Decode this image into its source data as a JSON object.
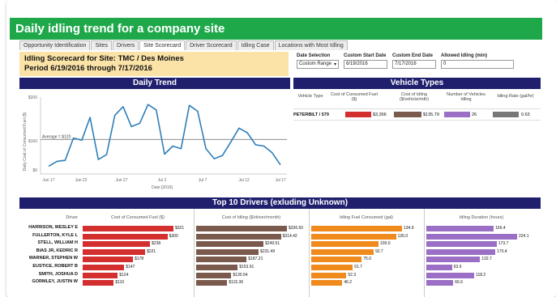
{
  "banner": {
    "title": "Daily idling trend for a company site"
  },
  "tabs": [
    {
      "label": "Opportunity Identification"
    },
    {
      "label": "Sites"
    },
    {
      "label": "Drivers"
    },
    {
      "label": "Site Scorecard"
    },
    {
      "label": "Driver Scorecard"
    },
    {
      "label": "Idling Case"
    },
    {
      "label": "Locations with Most Idling"
    }
  ],
  "scorecard": {
    "line1": "Idling Scorecard for Site: TMC / Des Moines",
    "line2": "Period 6/19/2016 through 7/17/2016"
  },
  "filters": {
    "date_selection_label": "Date Selection",
    "date_selection_value": "Custom Range",
    "start_label": "Custom Start Date",
    "start_value": "6/19/2016",
    "end_label": "Custom End Date",
    "end_value": "7/17/2016",
    "allowed_label": "Allowed Idling (min)",
    "allowed_value": "0"
  },
  "daily_trend": {
    "title": "Daily Trend",
    "ylabel": "Daily Cost of Consumed Fuel ($)",
    "xlabel": "Date [2016]",
    "average_label": "Average = $120",
    "ytick_labels": [
      "$200",
      "$100",
      "$0"
    ],
    "xtick_labels": [
      "Jun 17",
      "Jun 22",
      "Jun 27",
      "Jul 2",
      "Jul 7",
      "Jul 12",
      "Jul 17"
    ]
  },
  "chart_data": {
    "type": "line",
    "title": "Daily Trend",
    "xlabel": "Date [2016]",
    "ylabel": "Daily Cost of Consumed Fuel ($)",
    "ylim": [
      0,
      260
    ],
    "x": [
      "2016-06-19",
      "2016-06-20",
      "2016-06-21",
      "2016-06-22",
      "2016-06-23",
      "2016-06-24",
      "2016-06-25",
      "2016-06-26",
      "2016-06-27",
      "2016-06-28",
      "2016-06-29",
      "2016-06-30",
      "2016-07-01",
      "2016-07-02",
      "2016-07-03",
      "2016-07-04",
      "2016-07-05",
      "2016-07-06",
      "2016-07-07",
      "2016-07-08",
      "2016-07-09",
      "2016-07-10",
      "2016-07-11",
      "2016-07-12",
      "2016-07-13",
      "2016-07-14",
      "2016-07-15",
      "2016-07-16",
      "2016-07-17"
    ],
    "values": [
      20,
      38,
      42,
      125,
      117,
      202,
      45,
      63,
      210,
      242,
      168,
      180,
      250,
      230,
      65,
      95,
      85,
      247,
      225,
      85,
      48,
      60,
      110,
      162,
      145,
      100,
      95,
      70,
      25
    ],
    "average": 120,
    "grid": false
  },
  "vehicle_types": {
    "title": "Vehicle Types",
    "headers": [
      "Vehicle Type",
      "Cost of Consumed Fuel ($)",
      "Cost of Idling ($/vehicle/mth)",
      "Number of Vehicles Idling",
      "Idling Rate (gal/hr)"
    ],
    "row": {
      "type": "PETERBILT / 579",
      "fuel": "$3,366",
      "idling": "$135.79",
      "vehicles": "26",
      "rate": "0.63"
    },
    "colors": {
      "fuel": "#d32f2f",
      "idling": "#7b5a4e",
      "vehicles": "#9b6fc5",
      "rate": "#777777"
    }
  },
  "top_drivers": {
    "title": "Top 10 Drivers (exluding Unknown)",
    "headers": [
      "Driver",
      "Cost of Consumed Fuel ($)",
      "Cost of Idling ($/driver/month)",
      "Idling Fuel Consumed (gal)",
      "Idling Duration (hours)"
    ],
    "colors": {
      "fuel": "#d32f2f",
      "idling": "#7b5a4e",
      "gal": "#f08a1c",
      "hours": "#9b6fc5"
    },
    "rows": [
      {
        "name": "HARRISON, WESLEY E",
        "fuel": 321,
        "fuel_label": "$321",
        "idling": 336.5,
        "idling_label": "$336.50",
        "gal": 134.9,
        "gal_label": "134.9",
        "hours": 166.4,
        "hours_label": "166.4"
      },
      {
        "name": "FULLERTON, KYLE L",
        "fuel": 300,
        "fuel_label": "$300",
        "idling": 314.42,
        "idling_label": "$314.42",
        "gal": 126.0,
        "gal_label": "126.0",
        "hours": 224.1,
        "hours_label": "224.1"
      },
      {
        "name": "STELL, WILLIAM H",
        "fuel": 238,
        "fuel_label": "$238",
        "idling": 249.51,
        "idling_label": "$249.51",
        "gal": 100.0,
        "gal_label": "100.0",
        "hours": 173.7,
        "hours_label": "173.7"
      },
      {
        "name": "BIAS JR, KEDRIC R",
        "fuel": 221,
        "fuel_label": "$221",
        "idling": 231.49,
        "idling_label": "$231.49",
        "gal": 92.7,
        "gal_label": "92.7",
        "hours": 170.4,
        "hours_label": "170.4"
      },
      {
        "name": "WARNER, STEPHEN W",
        "fuel": 178,
        "fuel_label": "$178",
        "idling": 187.21,
        "idling_label": "$187.21",
        "gal": 75.0,
        "gal_label": "75.0",
        "hours": 132.7,
        "hours_label": "132.7"
      },
      {
        "name": "EUSTICE, ROBERT B",
        "fuel": 147,
        "fuel_label": "$147",
        "idling": 153.91,
        "idling_label": "$153.91",
        "gal": 61.7,
        "gal_label": "61.7",
        "hours": 63.6,
        "hours_label": "63.6"
      },
      {
        "name": "SMITH, JOSHUA D",
        "fuel": 124,
        "fuel_label": "$124",
        "idling": 130.54,
        "idling_label": "$130.54",
        "gal": 52.3,
        "gal_label": "52.3",
        "hours": 118.2,
        "hours_label": "118.2"
      },
      {
        "name": "GORMLEY, JUSTIN W",
        "fuel": 110,
        "fuel_label": "$110",
        "idling": 115.36,
        "idling_label": "$115.36",
        "gal": 46.2,
        "gal_label": "46.2",
        "hours": 66.6,
        "hours_label": "66.6"
      }
    ]
  }
}
